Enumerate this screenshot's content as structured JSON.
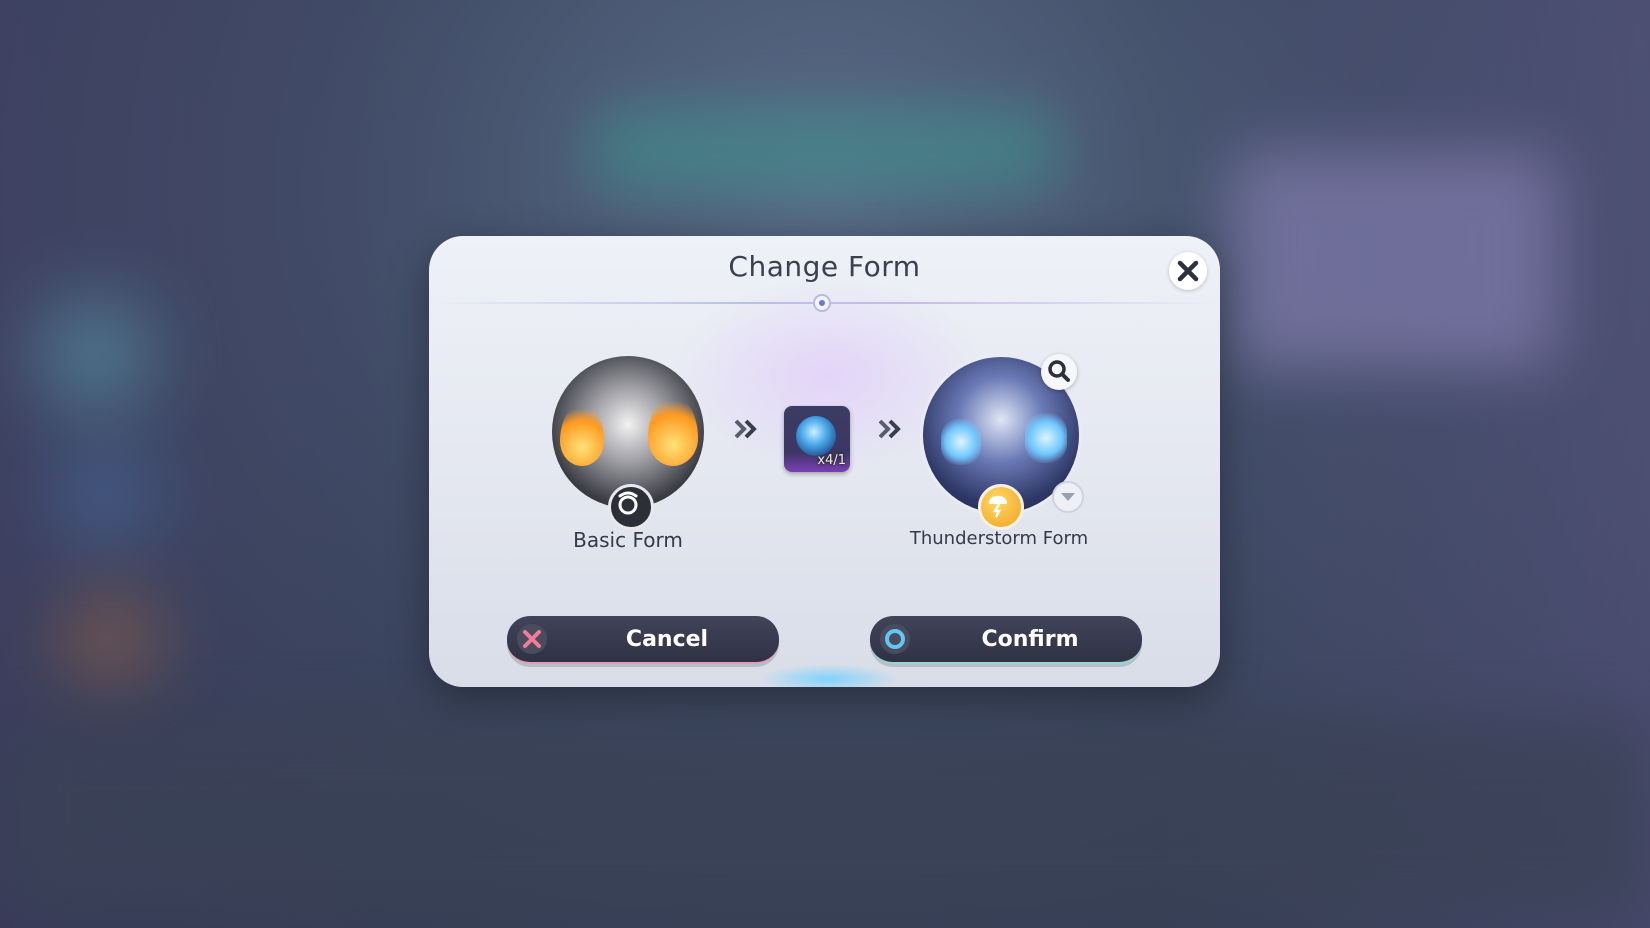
{
  "dialog": {
    "title": "Change Form",
    "close_icon": "close-icon",
    "source_form": {
      "label": "Basic Form",
      "badge_icon": "basic-form-badge-icon"
    },
    "required_item": {
      "icon": "form-change-item-icon",
      "count_text": "x4/1"
    },
    "target_form": {
      "label": "Thunderstorm Form",
      "badge_icon": "thunderstorm-badge-icon",
      "search_icon": "magnifier-icon",
      "dropdown_icon": "chevron-down-icon"
    },
    "buttons": {
      "cancel_label": "Cancel",
      "confirm_label": "Confirm"
    }
  },
  "colors": {
    "panel": "#e8ebf3",
    "button_bg": "#373a4e",
    "cancel_accent": "#e06a88",
    "confirm_accent": "#5ec7f2",
    "title_text": "#3b3f4e"
  }
}
